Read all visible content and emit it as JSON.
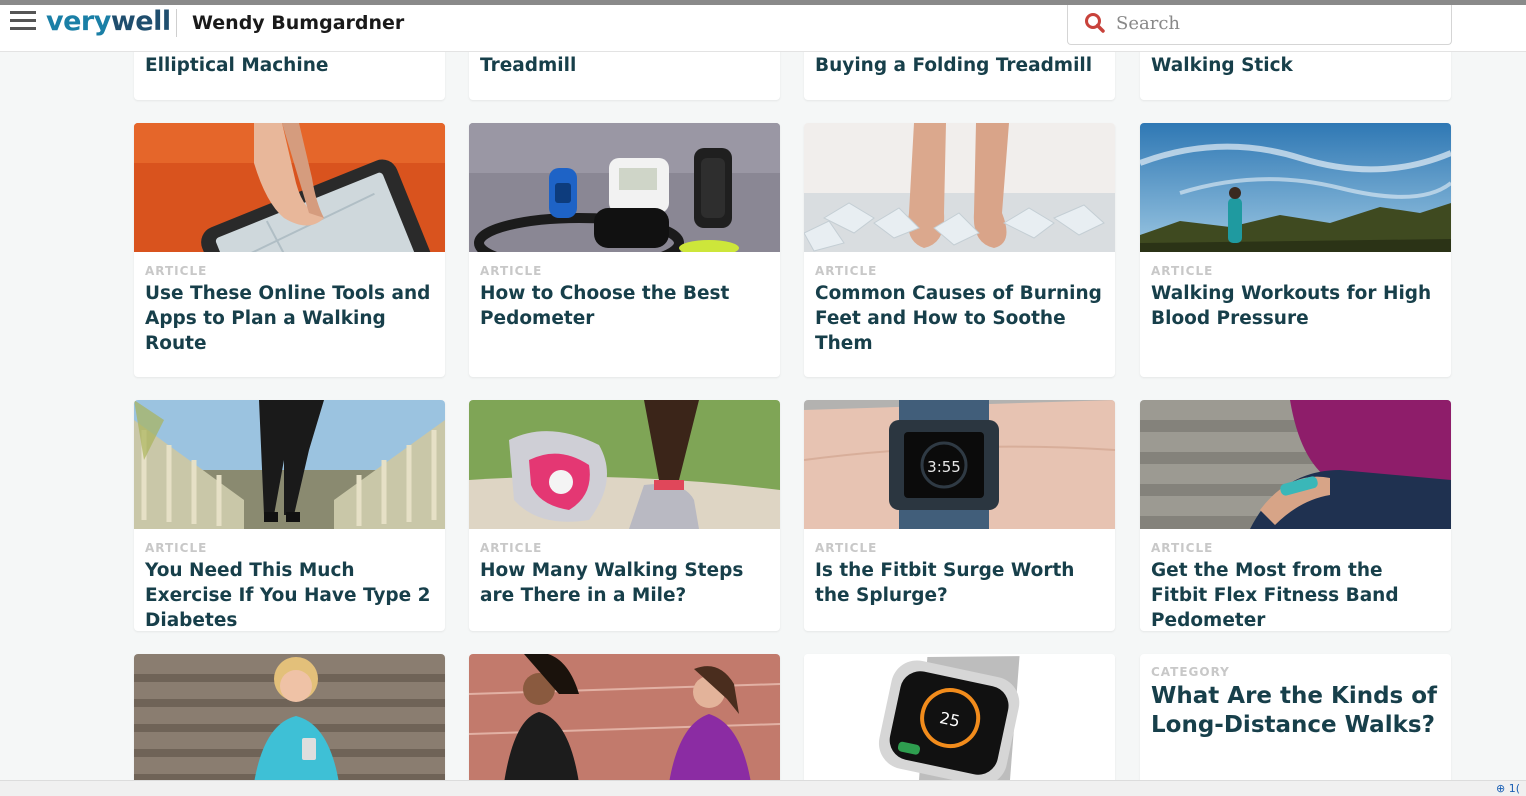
{
  "header": {
    "logo_part1": "very",
    "logo_part2": "well",
    "author": "Wendy Bumgardner",
    "search_placeholder": "Search"
  },
  "top_row": [
    {
      "title": "Elliptical Machine"
    },
    {
      "title": "Treadmill"
    },
    {
      "title": "Buying a Folding Treadmill"
    },
    {
      "title": "Walking Stick"
    }
  ],
  "cards": [
    {
      "kind": "ARTICLE",
      "title": "Use These Online Tools and Apps to Plan a Walking Route"
    },
    {
      "kind": "ARTICLE",
      "title": "How to Choose the Best Pedometer"
    },
    {
      "kind": "ARTICLE",
      "title": "Common Causes of Burning Feet and How to Soothe Them"
    },
    {
      "kind": "ARTICLE",
      "title": "Walking Workouts for High Blood Pressure"
    },
    {
      "kind": "ARTICLE",
      "title": "You Need This Much Exercise If You Have Type 2 Diabetes"
    },
    {
      "kind": "ARTICLE",
      "title": "How Many Walking Steps are There in a Mile?"
    },
    {
      "kind": "ARTICLE",
      "title": "Is the Fitbit Surge Worth the Splurge?"
    },
    {
      "kind": "ARTICLE",
      "title": "Get the Most from the Fitbit Flex Fitness Band Pedometer"
    }
  ],
  "category_card": {
    "kind": "CATEGORY",
    "title": "What Are the Kinds of Long-Distance Walks?"
  },
  "image_text": {
    "watch_time": "3:55",
    "apple_watch_numbers": "25"
  },
  "status": {
    "zoom": "⊕ 1("
  },
  "colors": {
    "brand_light": "#1a7fa6",
    "brand_dark": "#1f4e6e",
    "title": "#173f4a",
    "search_icon": "#c8423b"
  }
}
